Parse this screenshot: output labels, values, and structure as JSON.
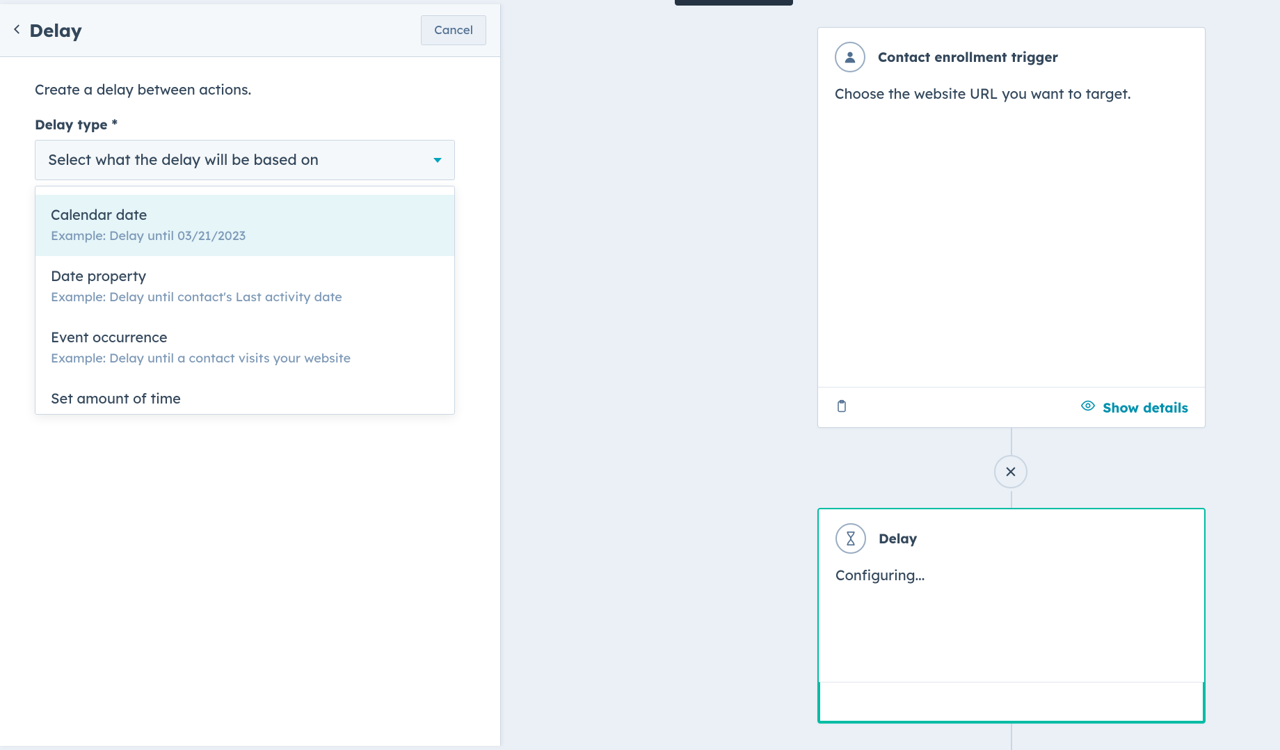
{
  "panel": {
    "title": "Delay",
    "cancel_label": "Cancel",
    "description": "Create a delay between actions.",
    "field_label": "Delay type *",
    "select_placeholder": "Select what the delay will be based on",
    "options": [
      {
        "title": "Calendar date",
        "sub": "Example: Delay until 03/21/2023"
      },
      {
        "title": "Date property",
        "sub": "Example: Delay until contact's Last activity date"
      },
      {
        "title": "Event occurrence",
        "sub": "Example: Delay until a contact visits your website"
      },
      {
        "title": "Set amount of time",
        "sub": ""
      }
    ]
  },
  "canvas": {
    "trigger": {
      "title": "Contact enrollment trigger",
      "body": "Choose the website URL you want to target.",
      "details_label": "Show details"
    },
    "delay": {
      "title": "Delay",
      "body": "Configuring..."
    }
  }
}
